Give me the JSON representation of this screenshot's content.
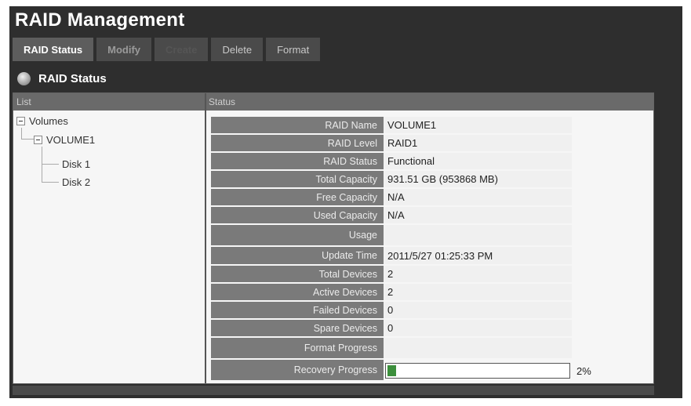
{
  "app": {
    "title": "RAID Management"
  },
  "tabs": [
    {
      "label": "RAID Status",
      "state": "active"
    },
    {
      "label": "Modify",
      "state": "normal"
    },
    {
      "label": "Create",
      "state": "disabled"
    },
    {
      "label": "Delete",
      "state": "light"
    },
    {
      "label": "Format",
      "state": "light"
    }
  ],
  "section": {
    "title": "RAID Status",
    "icon": "disc-icon"
  },
  "columns": {
    "list": "List",
    "status": "Status"
  },
  "tree": {
    "root": "Volumes",
    "volume": "VOLUME1",
    "disks": [
      "Disk 1",
      "Disk 2"
    ]
  },
  "status": {
    "raid_name": {
      "label": "RAID Name",
      "value": "VOLUME1"
    },
    "raid_level": {
      "label": "RAID Level",
      "value": "RAID1"
    },
    "raid_status": {
      "label": "RAID Status",
      "value": "Functional"
    },
    "total_capacity": {
      "label": "Total Capacity",
      "value": "931.51 GB (953868 MB)"
    },
    "free_capacity": {
      "label": "Free Capacity",
      "value": "N/A"
    },
    "used_capacity": {
      "label": "Used Capacity",
      "value": "N/A"
    },
    "usage": {
      "label": "Usage",
      "value": ""
    },
    "update_time": {
      "label": "Update Time",
      "value": "2011/5/27 01:25:33 PM"
    },
    "total_devices": {
      "label": "Total Devices",
      "value": "2"
    },
    "active_devices": {
      "label": "Active Devices",
      "value": "2"
    },
    "failed_devices": {
      "label": "Failed Devices",
      "value": "0"
    },
    "spare_devices": {
      "label": "Spare Devices",
      "value": "0"
    },
    "format_progress": {
      "label": "Format Progress",
      "value": ""
    },
    "recovery_progress": {
      "label": "Recovery Progress",
      "value": "2%",
      "fraction": 0.02
    }
  },
  "colors": {
    "progress": "#3c8f3c",
    "background": "#2e2e2e"
  }
}
